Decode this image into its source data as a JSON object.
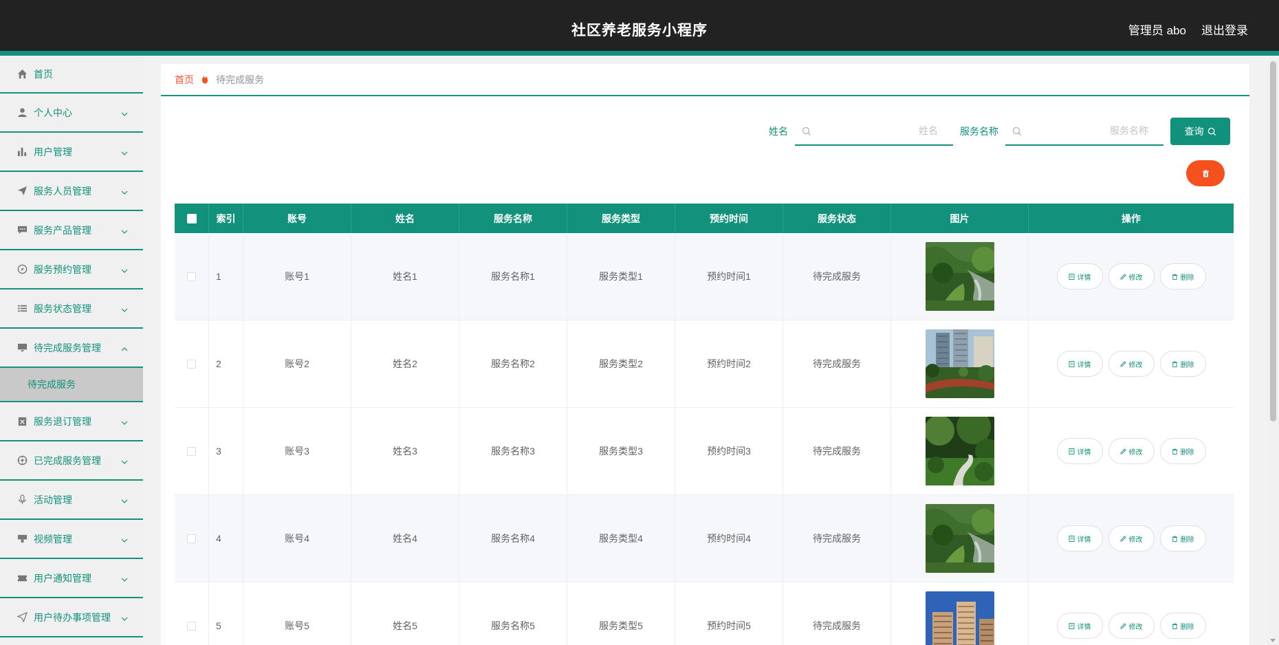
{
  "header": {
    "title": "社区养老服务小程序",
    "user": "管理员 abo",
    "logout": "退出登录"
  },
  "sidebar": {
    "items": [
      {
        "label": "首页",
        "icon": "home-icon"
      },
      {
        "label": "个人中心",
        "icon": "user-icon"
      },
      {
        "label": "用户管理",
        "icon": "bar-chart-icon"
      },
      {
        "label": "服务人员管理",
        "icon": "paper-plane-icon"
      },
      {
        "label": "服务产品管理",
        "icon": "chat-icon"
      },
      {
        "label": "服务预约管理",
        "icon": "compass-icon"
      },
      {
        "label": "服务状态管理",
        "icon": "list-icon"
      },
      {
        "label": "待完成服务管理",
        "icon": "monitor-icon"
      },
      {
        "label": "服务退订管理",
        "icon": "clipboard-x-icon"
      },
      {
        "label": "已完成服务管理",
        "icon": "dial-icon"
      },
      {
        "label": "活动管理",
        "icon": "microphone-icon"
      },
      {
        "label": "视频管理",
        "icon": "projector-icon"
      },
      {
        "label": "用户通知管理",
        "icon": "ticket-icon"
      },
      {
        "label": "用户待办事项管理",
        "icon": "send-icon"
      }
    ],
    "submenu": {
      "label": "待完成服务"
    }
  },
  "breadcrumb": {
    "home": "首页",
    "current": "待完成服务"
  },
  "search": {
    "name_label": "姓名",
    "name_placeholder": "姓名",
    "service_label": "服务名称",
    "service_placeholder": "服务名称",
    "query_button": "查询"
  },
  "table": {
    "headers": [
      "索引",
      "账号",
      "姓名",
      "服务名称",
      "服务类型",
      "预约时间",
      "服务状态",
      "图片",
      "操作"
    ],
    "rows": [
      {
        "index": "1",
        "account": "账号1",
        "name": "姓名1",
        "service": "服务名称1",
        "type": "服务类型1",
        "time": "预约时间1",
        "status": "待完成服务",
        "image": "garden-stream"
      },
      {
        "index": "2",
        "account": "账号2",
        "name": "姓名2",
        "service": "服务名称2",
        "type": "服务类型2",
        "time": "预约时间2",
        "status": "待完成服务",
        "image": "apartment-garden"
      },
      {
        "index": "3",
        "account": "账号3",
        "name": "姓名3",
        "service": "服务名称3",
        "type": "服务类型3",
        "time": "预约时间3",
        "status": "待完成服务",
        "image": "garden-path"
      },
      {
        "index": "4",
        "account": "账号4",
        "name": "姓名4",
        "service": "服务名称4",
        "type": "服务类型4",
        "time": "预约时间4",
        "status": "待完成服务",
        "image": "garden-stream"
      },
      {
        "index": "5",
        "account": "账号5",
        "name": "姓名5",
        "service": "服务名称5",
        "type": "服务类型5",
        "time": "预约时间5",
        "status": "待完成服务",
        "image": "apartment-towers"
      }
    ],
    "actions": {
      "detail": "详情",
      "edit": "修改",
      "delete": "删除"
    }
  },
  "colors": {
    "accent": "#12917c",
    "header_bg": "#222222",
    "danger": "#f4511e",
    "breadcrumb_home": "#f0523e"
  }
}
